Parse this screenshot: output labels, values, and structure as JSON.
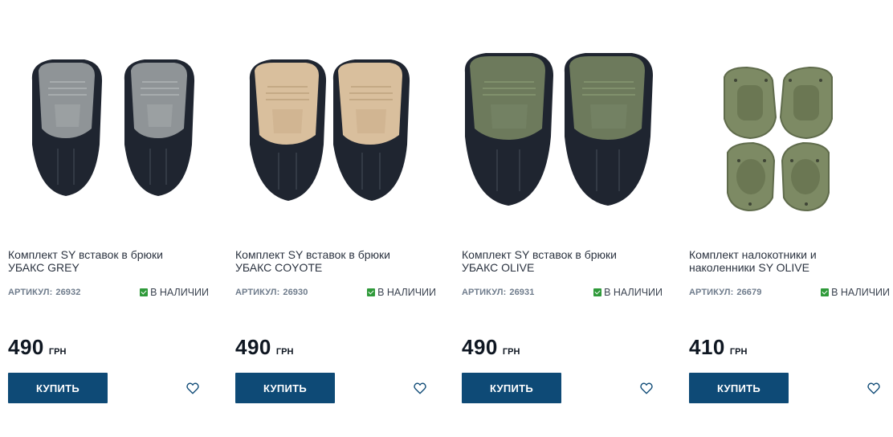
{
  "products": [
    {
      "title_line1": "Комплект SY вставок в брюки",
      "title_line2": "УБАКС GREY",
      "sku_label": "АРТИКУЛ:",
      "sku": "26932",
      "stock": "В НАЛИЧИИ",
      "price": "490",
      "currency": "ГРН",
      "buy_label": "КУПИТЬ",
      "image_color": "#8f9497",
      "wishlist_icon": "heart-icon"
    },
    {
      "title_line1": "Комплект SY вставок в брюки",
      "title_line2": "УБАКС COYOTE",
      "sku_label": "АРТИКУЛ:",
      "sku": "26930",
      "stock": "В НАЛИЧИИ",
      "price": "490",
      "currency": "ГРН",
      "buy_label": "КУПИТЬ",
      "image_color": "#d9bf9d",
      "wishlist_icon": "heart-icon"
    },
    {
      "title_line1": "Комплект SY вставок в брюки",
      "title_line2": "УБАКС OLIVE",
      "sku_label": "АРТИКУЛ:",
      "sku": "26931",
      "stock": "В НАЛИЧИИ",
      "price": "490",
      "currency": "ГРН",
      "buy_label": "КУПИТЬ",
      "image_color": "#6d7a5c",
      "wishlist_icon": "heart-icon"
    },
    {
      "title_line1": "Комплект налокотники и",
      "title_line2": "наколенники SY OLIVE",
      "sku_label": "АРТИКУЛ:",
      "sku": "26679",
      "stock": "В НАЛИЧИИ",
      "price": "410",
      "currency": "ГРН",
      "buy_label": "КУПИТЬ",
      "image_color": "#7d8a64",
      "wishlist_icon": "heart-icon"
    }
  ],
  "colors": {
    "buy_button": "#0e4a76",
    "in_stock": "#2f9a3a",
    "sku_text": "#6f7c8c"
  }
}
